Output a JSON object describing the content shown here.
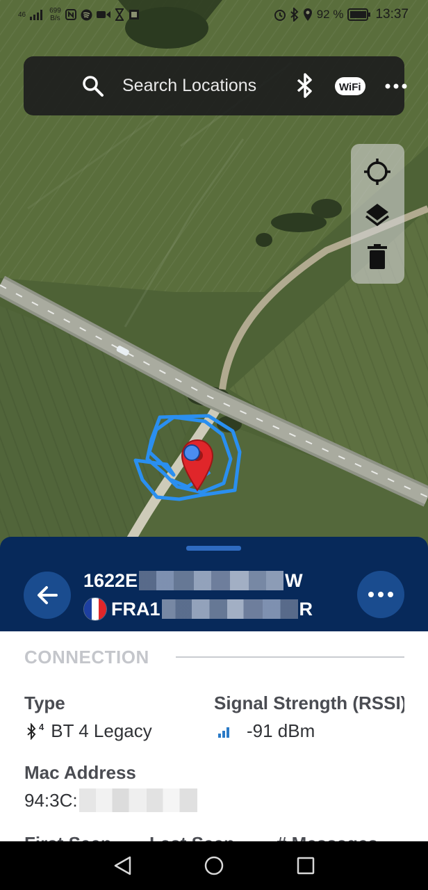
{
  "status_bar": {
    "network": "46",
    "speed_value": "699",
    "speed_unit": "B/s",
    "battery_percent": "92 %",
    "time": "13:37",
    "icons": [
      "signal-icon",
      "nfc-icon",
      "spotify-icon",
      "video-icon",
      "hourglass-icon",
      "alarm-icon",
      "bluetooth-icon",
      "location-icon",
      "battery-icon"
    ]
  },
  "search": {
    "placeholder": "Search Locations",
    "icons": [
      "search-icon",
      "bluetooth-icon",
      "wifi-icon",
      "more-icon"
    ]
  },
  "map_tools": {
    "icons": [
      "locate-icon",
      "layers-icon",
      "delete-icon"
    ]
  },
  "header": {
    "device_id_prefix": "1622E",
    "device_id_suffix": "W",
    "registration_prefix": "FRA1",
    "registration_suffix": "R",
    "country_flag": "france-flag-icon"
  },
  "connection": {
    "section_title": "CONNECTION",
    "type_label": "Type",
    "type_badge": "4",
    "type_value": "BT 4 Legacy",
    "signal_label": "Signal Strength (RSSI)",
    "signal_value": "-91 dBm",
    "mac_label": "Mac Address",
    "mac_prefix": "94:3C:"
  },
  "next_row": {
    "first_seen_label": "First Seen",
    "last_seen_label": "Last Seen",
    "messages_label": "# Messages"
  },
  "colors": {
    "sheet_header": "#07295a",
    "accent_button": "#1a4c8f",
    "drag_handle": "#2f6bc0",
    "track": "#2a8ff0",
    "pin": "#e0262a",
    "signal_bars": "#2a7ac7"
  },
  "nav": {
    "icons": [
      "back-nav-icon",
      "home-nav-icon",
      "recents-nav-icon"
    ]
  }
}
